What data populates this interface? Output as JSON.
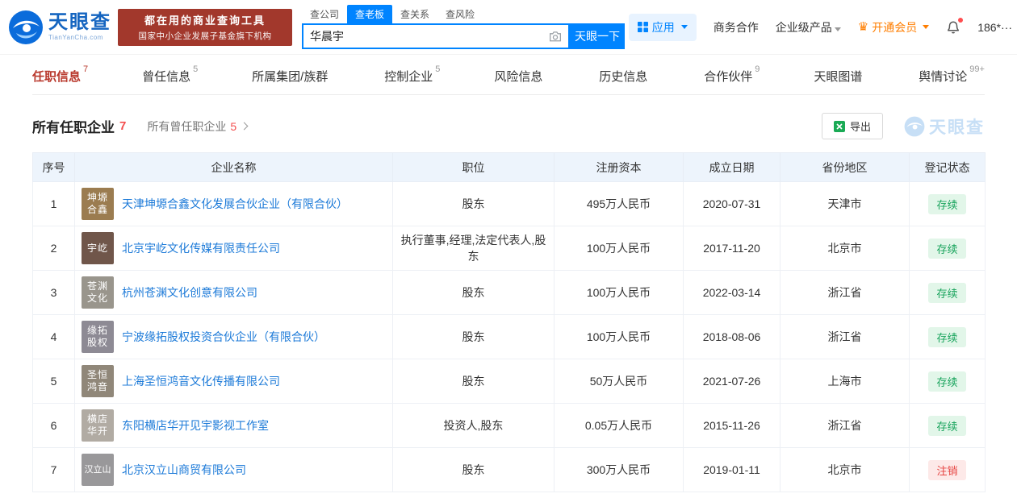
{
  "colors": {
    "brand_blue": "#0084ff",
    "active_tab_red": "#b9392d",
    "link_blue": "#1c7ad8",
    "vip_orange": "#ff7e00",
    "status_green": "#17a35b",
    "status_red": "#e64340",
    "banner_red": "#a2382c"
  },
  "header": {
    "logo": {
      "text": "天眼查",
      "sub": "TianYanCha.com"
    },
    "banner": {
      "line1": "都在用的商业查询工具",
      "line2": "国家中小企业发展子基金旗下机构"
    },
    "search_tabs": [
      {
        "label": "查公司"
      },
      {
        "label": "查老板"
      },
      {
        "label": "查关系"
      },
      {
        "label": "查风险"
      }
    ],
    "search": {
      "value": "华晨宇",
      "button": "天眼一下"
    },
    "nav": {
      "apps": "应用",
      "business": "商务合作",
      "enterprise": "企业级产品",
      "vip": "开通会员",
      "phone": "186*···"
    }
  },
  "icons": {
    "crown": "♛"
  },
  "tabs": [
    {
      "label": "任职信息",
      "count": "7",
      "active": true
    },
    {
      "label": "曾任信息",
      "count": "5",
      "active": false
    },
    {
      "label": "所属集团/族群",
      "count": "",
      "active": false
    },
    {
      "label": "控制企业",
      "count": "5",
      "active": false
    },
    {
      "label": "风险信息",
      "count": "",
      "active": false
    },
    {
      "label": "历史信息",
      "count": "",
      "active": false
    },
    {
      "label": "合作伙伴",
      "count": "9",
      "active": false
    },
    {
      "label": "天眼图谱",
      "count": "",
      "active": false
    },
    {
      "label": "舆情讨论",
      "count": "99+",
      "active": false
    }
  ],
  "section": {
    "title": "所有任职企业",
    "count": "7",
    "sub_title": "所有曾任职企业",
    "sub_count": "5",
    "export_label": "导出",
    "watermark": "天眼查"
  },
  "table": {
    "columns": [
      "序号",
      "企业名称",
      "职位",
      "注册资本",
      "成立日期",
      "省份地区",
      "登记状态"
    ],
    "rows": [
      {
        "no": "1",
        "icon1": "坤塬",
        "icon2": "合鑫",
        "name": "天津坤塬合鑫文化发展合伙企业（有限合伙）",
        "position": "股东",
        "capital": "495万人民币",
        "date": "2020-07-31",
        "region": "天津市",
        "status": "存续",
        "state": "active"
      },
      {
        "no": "2",
        "icon1": "宇屹",
        "icon2": "",
        "name": "北京宇屹文化传媒有限责任公司",
        "position": "执行董事,经理,法定代表人,股东",
        "capital": "100万人民币",
        "date": "2017-11-20",
        "region": "北京市",
        "status": "存续",
        "state": "active"
      },
      {
        "no": "3",
        "icon1": "苍渊",
        "icon2": "文化",
        "name": "杭州苍渊文化创意有限公司",
        "position": "股东",
        "capital": "100万人民币",
        "date": "2022-03-14",
        "region": "浙江省",
        "status": "存续",
        "state": "active"
      },
      {
        "no": "4",
        "icon1": "缘拓",
        "icon2": "股权",
        "name": "宁波缘拓股权投资合伙企业（有限合伙）",
        "position": "股东",
        "capital": "100万人民币",
        "date": "2018-08-06",
        "region": "浙江省",
        "status": "存续",
        "state": "active"
      },
      {
        "no": "5",
        "icon1": "圣恒",
        "icon2": "鸿音",
        "name": "上海圣恒鸿音文化传播有限公司",
        "position": "股东",
        "capital": "50万人民币",
        "date": "2021-07-26",
        "region": "上海市",
        "status": "存续",
        "state": "active"
      },
      {
        "no": "6",
        "icon1": "横店",
        "icon2": "华开",
        "name": "东阳横店华开见宇影视工作室",
        "position": "投资人,股东",
        "capital": "0.05万人民币",
        "date": "2015-11-26",
        "region": "浙江省",
        "status": "存续",
        "state": "active"
      },
      {
        "no": "7",
        "icon1": "汉立山",
        "icon2": "",
        "name": "北京汉立山商贸有限公司",
        "position": "股东",
        "capital": "300万人民币",
        "date": "2019-01-11",
        "region": "北京市",
        "status": "注销",
        "state": "cancelled"
      }
    ]
  }
}
